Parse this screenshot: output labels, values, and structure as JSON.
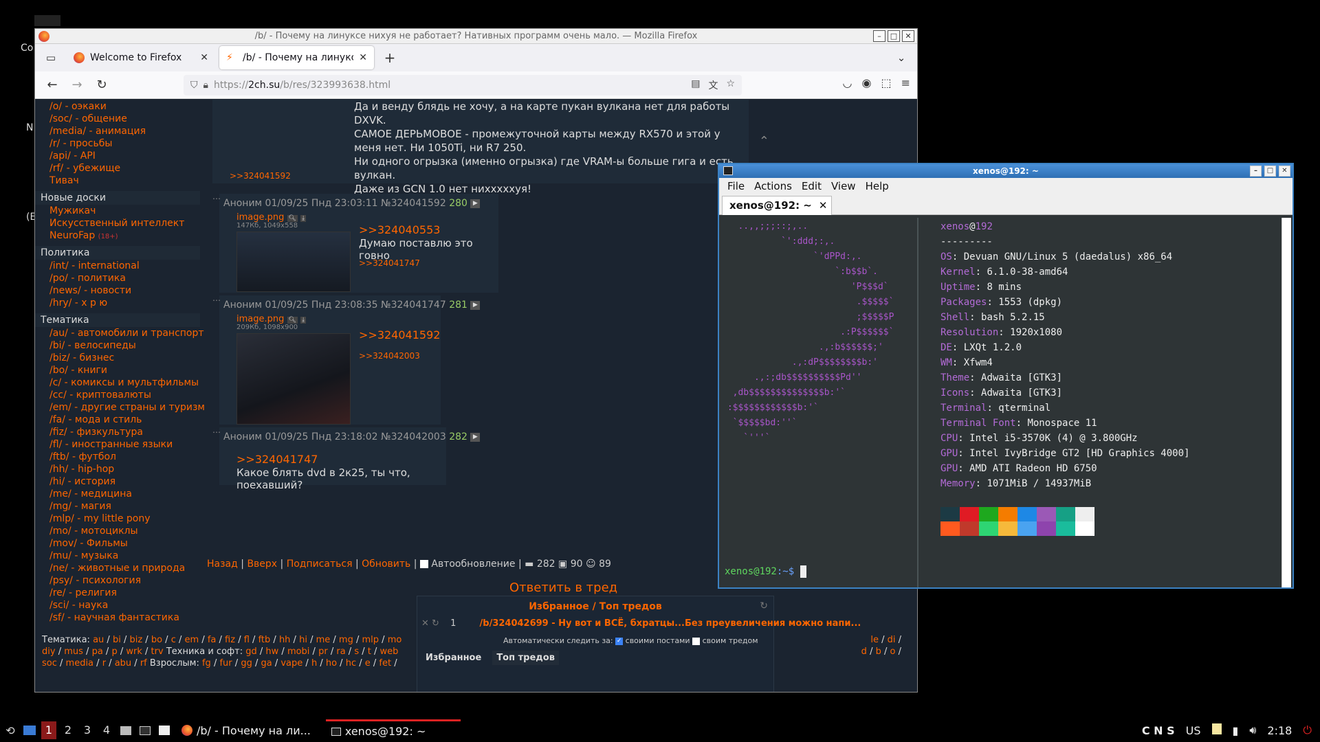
{
  "desktop": {
    "labels": [
      "Co",
      "N",
      "(E",
      "ª"
    ]
  },
  "firefox": {
    "window_title": "/b/ - Почему на линуксе нихуя не работает? Нативных программ очень мало. — Mozilla Firefox",
    "tabs": [
      {
        "label": "Welcome to Firefox",
        "active": false
      },
      {
        "label": "/b/ - Почему на линуксе",
        "active": true
      }
    ],
    "url": {
      "scheme": "https://",
      "host": "2ch.su",
      "path": "/b/res/323993638.html"
    }
  },
  "sidebar": {
    "top_items": [
      "/o/ - оэкаки",
      "/soc/ - общение",
      "/media/ - анимация",
      "/r/ - просьбы",
      "/api/ - API",
      "/rf/ - убежище",
      "Тивач"
    ],
    "sections": [
      {
        "title": "Новые доски",
        "items": [
          "Мужикач",
          "Искусственный интеллект",
          "NeuroFap"
        ],
        "badge": "(18+)"
      },
      {
        "title": "Политика",
        "items": [
          "/int/ - international",
          "/po/ - политика",
          "/news/ - новости",
          "/hry/ - х р ю"
        ]
      },
      {
        "title": "Тематика",
        "items": [
          "/au/ - автомобили и транспорт",
          "/bi/ - велосипеды",
          "/biz/ - бизнес",
          "/bo/ - книги",
          "/c/ - комиксы и мультфильмы",
          "/cc/ - криптовалюты",
          "/em/ - другие страны и туризм",
          "/fa/ - мода и стиль",
          "/fiz/ - физкультура",
          "/fl/ - иностранные языки",
          "/ftb/ - футбол",
          "/hh/ - hip-hop",
          "/hi/ - история",
          "/me/ - медицина",
          "/mg/ - магия",
          "/mlp/ - my little pony",
          "/mo/ - мотоциклы",
          "/mov/ - Фильмы",
          "/mu/ - музыка",
          "/ne/ - животные и природа",
          "/psy/ - психология",
          "/re/ - религия",
          "/sci/ - наука",
          "/sf/ - научная фантастика"
        ]
      }
    ]
  },
  "posts": {
    "top": {
      "lines": [
        "Да и венду блядь не хочу, а на карте пукан вулкана нет для работы DXVK.",
        "САМОЕ ДЕРЬМОВОЕ - промежуточной карты между RX570 и этой у меня нет. Ни 1050Ti, ни R7 250.",
        "Ни одного огрызка (именно огрызка) где VRAM-ы больше гига и есть вулкан.",
        "Даже из GCN 1.0 нет нихххххуя!"
      ],
      "reply_ref": ">>324041592"
    },
    "p1": {
      "header": "Аноним 01/09/25 Пнд 23:03:11 №324041592",
      "num": "280",
      "img": "image.png",
      "meta": "147Кб, 1049x558",
      "ref": ">>324040553",
      "text": "Думаю поставлю это говно",
      "reply": ">>324041747"
    },
    "p2": {
      "header": "Аноним 01/09/25 Пнд 23:08:35 №324041747",
      "num": "281",
      "img": "image.png",
      "meta": "209Кб, 1098x900",
      "ref": ">>324041592",
      "reply": ">>324042003"
    },
    "p3": {
      "header": "Аноним 01/09/25 Пнд 23:18:02 №324042003",
      "num": "282",
      "ref": ">>324041747",
      "text": "Какое блять dvd в 2к25, ты что, поехавший?"
    }
  },
  "thread_footer": {
    "links": [
      "Назад",
      "Вверх",
      "Подписаться",
      "Обновить"
    ],
    "auto": "Автообновление",
    "counts": [
      "282",
      "90",
      "89"
    ],
    "reply": "Ответить в тред"
  },
  "favorites": {
    "title": "Избранное / Топ тредов",
    "row_num": "1",
    "row_link": "/b/324042699 - Ну вот и ВСЁ, бхратцы...Без преувеличения можно напи...",
    "auto_label": "Автоматически следить за:",
    "opt1": "своими постами",
    "opt2": "своим тредом",
    "tab1": "Избранное",
    "tab2": "Топ тредов"
  },
  "bottom_bar": {
    "line1_prefix": "Тематика:",
    "line1": [
      "au",
      "bi",
      "biz",
      "bo",
      "c",
      "em",
      "fa",
      "fiz",
      "fl",
      "ftb",
      "hh",
      "hi",
      "me",
      "mg",
      "mlp",
      "mo"
    ],
    "line1_right": [
      "le",
      "di"
    ],
    "line2": [
      "diy",
      "mus",
      "pa",
      "p",
      "wrk",
      "trv"
    ],
    "line2_mid": "Техника и софт:",
    "line2b": [
      "gd",
      "hw",
      "mobi",
      "pr",
      "ra",
      "s",
      "t",
      "web"
    ],
    "line2_right": [
      "d",
      "b",
      "o"
    ],
    "line3": [
      "soc",
      "media",
      "r",
      "abu",
      "rf"
    ],
    "line3_mid": "Взрослым:",
    "line3b": [
      "fg",
      "fur",
      "gg",
      "ga",
      "vape",
      "h",
      "ho",
      "hc",
      "e",
      "fet"
    ]
  },
  "terminal": {
    "window_title": "xenos@192: ~",
    "menu": [
      "File",
      "Actions",
      "Edit",
      "View",
      "Help"
    ],
    "tab": "xenos@192: ~",
    "user": "xenos",
    "host": "192",
    "sep": "---------",
    "info": [
      {
        "k": "OS",
        "v": "Devuan GNU/Linux 5 (daedalus) x86_64"
      },
      {
        "k": "Kernel",
        "v": "6.1.0-38-amd64"
      },
      {
        "k": "Uptime",
        "v": "8 mins"
      },
      {
        "k": "Packages",
        "v": "1553 (dpkg)"
      },
      {
        "k": "Shell",
        "v": "bash 5.2.15"
      },
      {
        "k": "Resolution",
        "v": "1920x1080"
      },
      {
        "k": "DE",
        "v": "LXQt 1.2.0"
      },
      {
        "k": "WM",
        "v": "Xfwm4"
      },
      {
        "k": "Theme",
        "v": "Adwaita [GTK3]"
      },
      {
        "k": "Icons",
        "v": "Adwaita [GTK3]"
      },
      {
        "k": "Terminal",
        "v": "qterminal"
      },
      {
        "k": "Terminal Font",
        "v": "Monospace 11"
      },
      {
        "k": "CPU",
        "v": "Intel i5-3570K (4) @ 3.800GHz"
      },
      {
        "k": "GPU",
        "v": "Intel IvyBridge GT2 [HD Graphics 4000]"
      },
      {
        "k": "GPU",
        "v": "AMD ATI Radeon HD 6750"
      },
      {
        "k": "Memory",
        "v": "1071MiB / 14937MiB"
      }
    ],
    "logo": "   ..,,;;;::;,..\n           `':ddd;:,.\n                 `'dPPd:,.\n                     `:b$$b`.\n                        'P$$$d`\n                         .$$$$$`\n                         ;$$$$$P\n                      .:P$$$$$$`\n                  .,:b$$$$$$;'\n             .,:dP$$$$$$$$b:'\n      .,:;db$$$$$$$$$$Pd''\n  ,db$$$$$$$$$$$$$$b:'`\n :$$$$$$$$$$$$b:'`\n  `$$$$$bd:''`\n    `'''`",
    "colors_row1": [
      "#1c3a44",
      "#e01b24",
      "#1ea81e",
      "#f57c00",
      "#1e88e5",
      "#9b59b6",
      "#16a085",
      "#eeeeee"
    ],
    "colors_row2": [
      "#ff5a1f",
      "#c0392b",
      "#2ed573",
      "#f6b93b",
      "#4aa3f0",
      "#8e44ad",
      "#1abc9c",
      "#ffffff"
    ],
    "prompt_user": "xenos@192",
    "prompt_path": ":~$"
  },
  "taskbar": {
    "workspaces": [
      "1",
      "2",
      "3",
      "4"
    ],
    "tasks": [
      {
        "label": "/b/ - Почему на ли...",
        "active": false
      },
      {
        "label": "xenos@192: ~",
        "active": true
      }
    ],
    "indicators": "C N S",
    "layout": "US",
    "clock": "2:18"
  }
}
